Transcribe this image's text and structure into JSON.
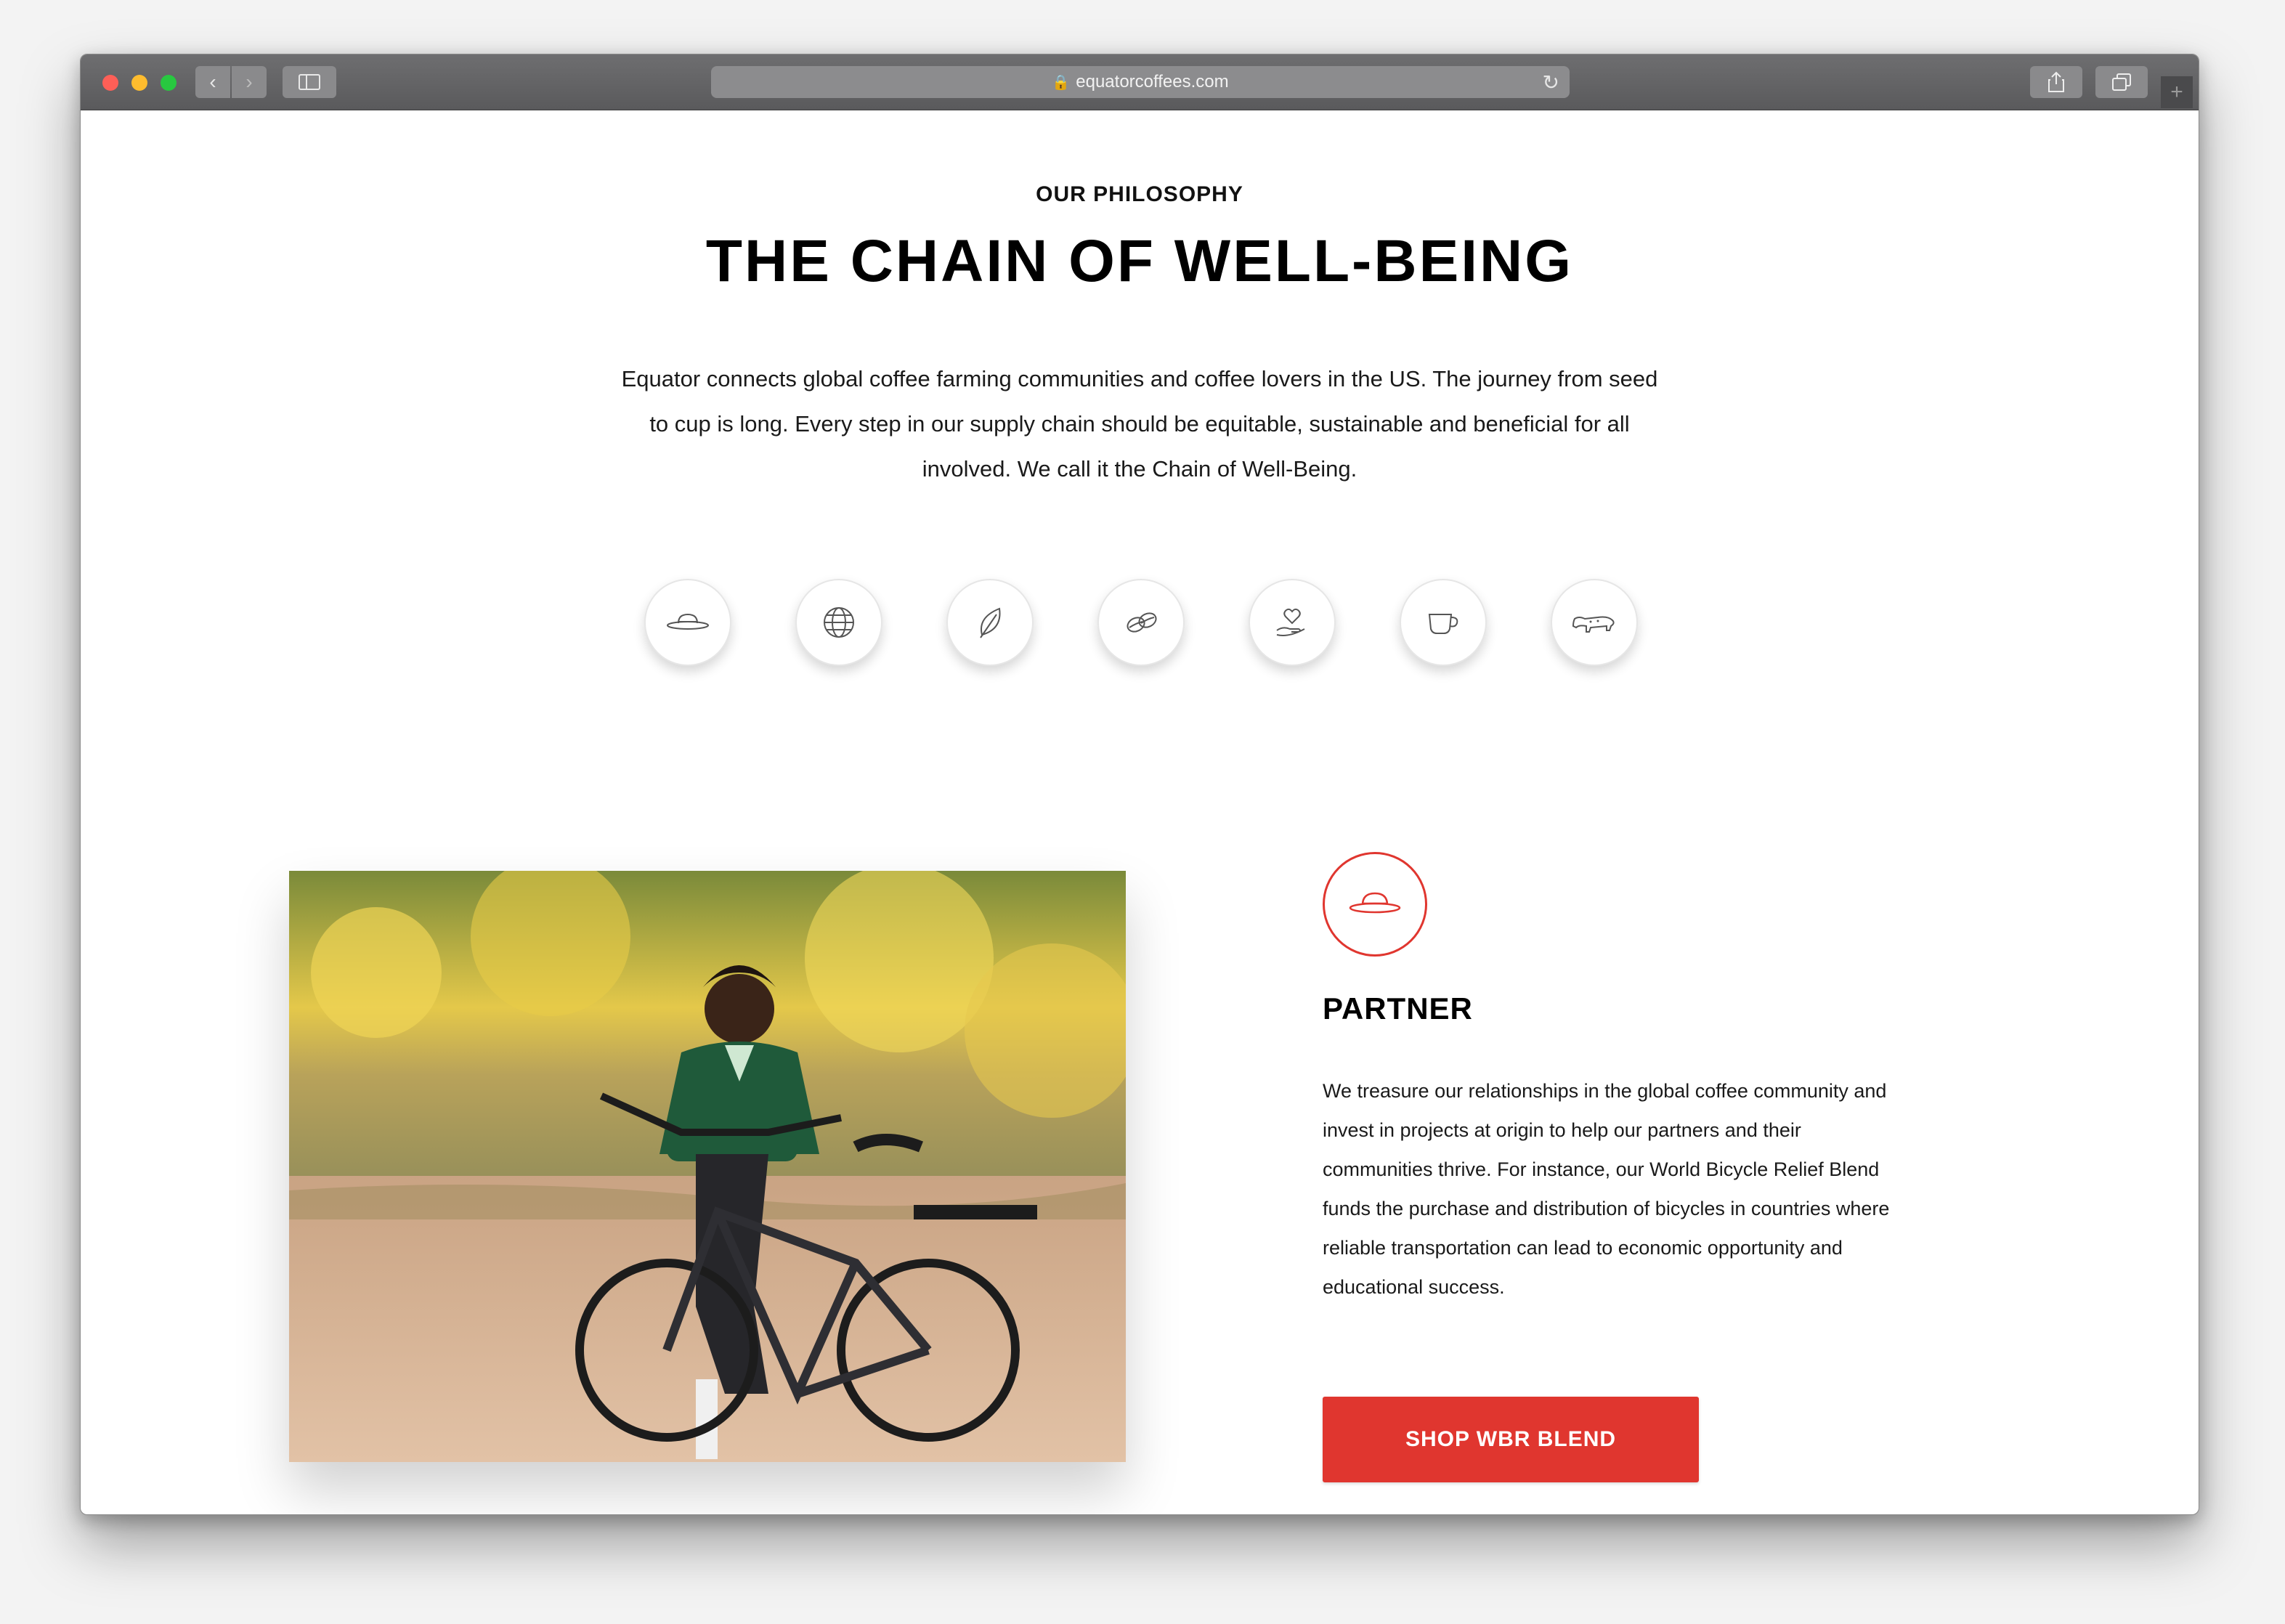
{
  "browser": {
    "url": "equatorcoffees.com",
    "back_icon": "chevron-left-icon",
    "forward_icon": "chevron-right-icon",
    "sidebar_icon": "sidebar-icon",
    "reload_icon": "reload-icon",
    "share_icon": "share-icon",
    "tabs_icon": "tabs-overview-icon",
    "new_tab_icon": "plus-icon"
  },
  "section": {
    "eyebrow": "OUR PHILOSOPHY",
    "title": "THE CHAIN OF WELL-BEING",
    "intro": "Equator connects global coffee farming communities and coffee lovers in the US. The journey from seed to cup is long. Every step in our supply chain should be equitable, sustainable and beneficial for all involved. We call it the Chain of Well-Being."
  },
  "chain_icons": [
    {
      "name": "hat-icon"
    },
    {
      "name": "globe-icon"
    },
    {
      "name": "leaf-icon"
    },
    {
      "name": "coffee-beans-icon"
    },
    {
      "name": "hand-heart-icon"
    },
    {
      "name": "coffee-cup-icon"
    },
    {
      "name": "jaguar-icon"
    }
  ],
  "feature": {
    "icon": "hat-icon",
    "title": "PARTNER",
    "text": "We treasure our relationships in the global coffee community and invest in projects at origin to help our partners and their communities thrive. For instance, our World Bicycle Relief Blend funds the purchase and distribution of bicycles in countries where reliable transportation can lead to economic opportunity and educational success.",
    "cta_label": "SHOP WBR BLEND"
  },
  "colors": {
    "accent": "#e0362f",
    "text": "#000000",
    "icon_stroke": "#555555"
  }
}
